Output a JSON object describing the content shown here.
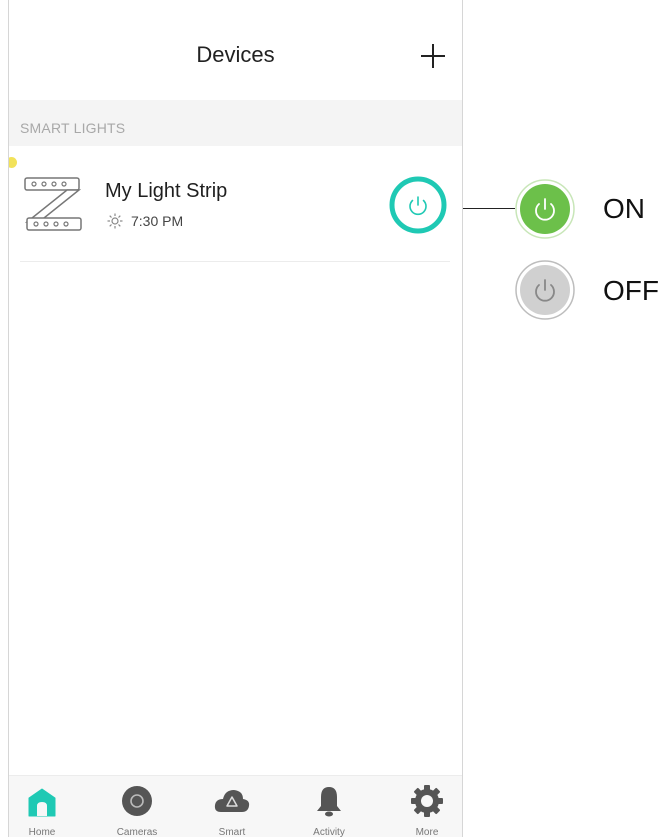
{
  "header": {
    "title": "Devices",
    "add_icon": "plus-icon"
  },
  "section": {
    "label": "SMART LIGHTS"
  },
  "device": {
    "name": "My Light Strip",
    "schedule_icon": "sun-icon",
    "schedule_time": "7:30 PM",
    "power_icon": "power-icon",
    "power_color": "#1fc9b4"
  },
  "tabbar": {
    "active_color": "#1fc9b4",
    "tabs": [
      {
        "label": "Home",
        "icon": "home-icon"
      },
      {
        "label": "Cameras",
        "icon": "camera-icon"
      },
      {
        "label": "Smart",
        "icon": "cloud-icon"
      },
      {
        "label": "Activity",
        "icon": "bell-icon"
      },
      {
        "label": "More",
        "icon": "gear-icon"
      }
    ]
  },
  "legend": {
    "on_label": "ON",
    "off_label": "OFF",
    "on_color": "#6cc04a",
    "off_color": "#d0d0d0"
  }
}
